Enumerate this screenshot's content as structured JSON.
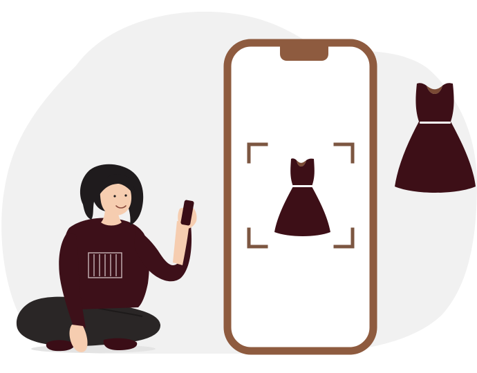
{
  "illustration": {
    "subject": "visual-search",
    "colors": {
      "backdrop_blob": "#f1f1f1",
      "phone_frame": "#8e5b3f",
      "phone_screen": "#ffffff",
      "scan_corners": "#7c5641",
      "dress": "#3d0f17",
      "dress_neckline": "#7a4a35",
      "dress_belt": "#ffffff",
      "woman_hair": "#1f1b1d",
      "woman_skin": "#f6cdb0",
      "woman_sweater": "#3d1019",
      "woman_pants": "#2a2626",
      "held_phone": "#3a0d16"
    },
    "icons": [
      "dress-icon",
      "scan-frame-icon",
      "phone-icon"
    ]
  }
}
